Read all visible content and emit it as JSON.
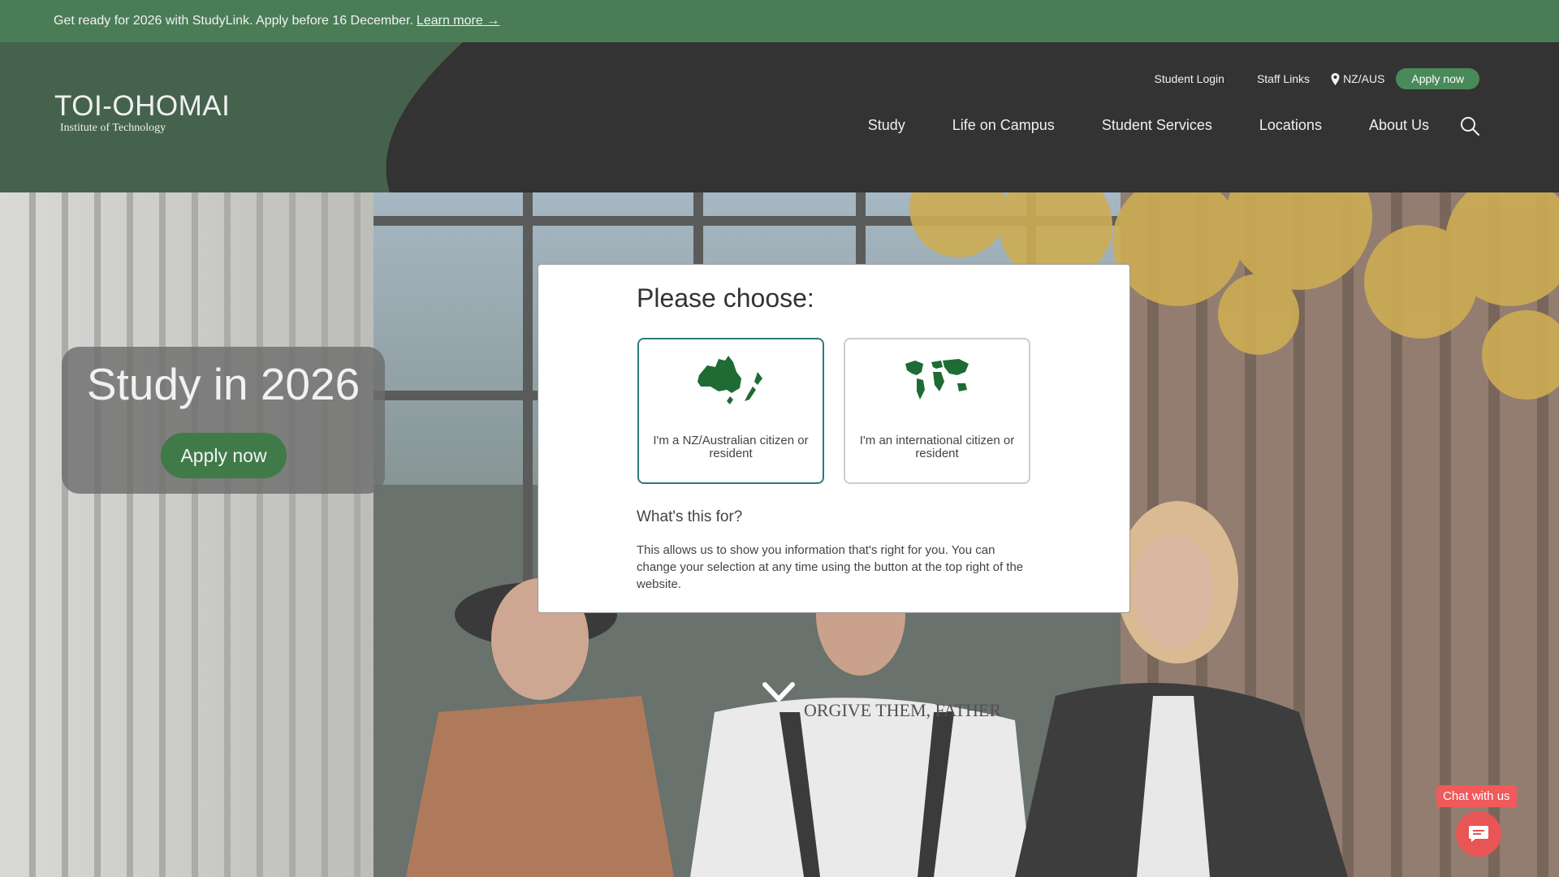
{
  "announcement": {
    "text": "Get ready for 2026 with StudyLink. Apply before 16 December.",
    "link": "Learn more →"
  },
  "logo": {
    "wordmark": "TOI-OHOMAI",
    "subtitle": "Institute of Technology"
  },
  "utility_nav": {
    "student_login": "Student Login",
    "staff_links": "Staff Links",
    "region": "NZ/AUS",
    "apply": "Apply now"
  },
  "main_nav": [
    "Study",
    "Life on Campus",
    "Student Services",
    "Locations",
    "About Us"
  ],
  "hero": {
    "title": "Study in 2026",
    "cta": "Apply now",
    "shirt_text": "ORGIVE THEM, FATHER"
  },
  "modal": {
    "heading": "Please choose:",
    "choices": [
      {
        "icon": "australia-nz-map-icon",
        "label": "I'm a NZ/Australian citizen or resident"
      },
      {
        "icon": "world-map-icon",
        "label": "I'm an international citizen or resident"
      }
    ],
    "sub_heading": "What's this for?",
    "description": "This allows us to show you information that's right for you. You can change your selection at any time using the button at the top right of the website."
  },
  "chat": {
    "label": "Chat with us"
  },
  "colors": {
    "banner_green": "#4a7d56",
    "header_dark": "#333333",
    "header_green": "#45634c",
    "brand_green": "#3f7a48",
    "chat_red": "#e95454",
    "selected_border": "#2e7a7a"
  }
}
